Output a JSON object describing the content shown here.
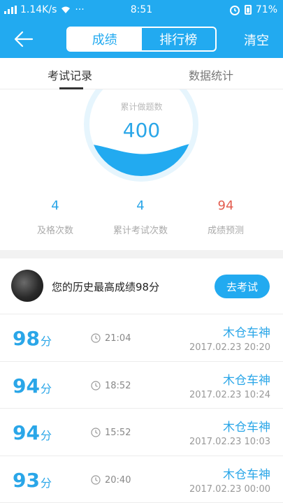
{
  "status": {
    "speed": "1.14K/s",
    "dots": "···",
    "time": "8:51",
    "battery": "71%"
  },
  "header": {
    "segments": [
      "成绩",
      "排行榜"
    ],
    "clear": "清空"
  },
  "tabs": [
    "考试记录",
    "数据统计"
  ],
  "gauge": {
    "title": "累计做题数",
    "value": "400"
  },
  "stats": [
    {
      "value": "4",
      "label": "及格次数",
      "color": "#2aa6e8"
    },
    {
      "value": "4",
      "label": "累计考试次数",
      "color": "#2aa6e8"
    },
    {
      "value": "94",
      "label": "成绩预测",
      "color": "#e35c4f"
    }
  ],
  "best": {
    "text": "您的历史最高成绩98分",
    "button": "去考试"
  },
  "records": [
    {
      "score": "98",
      "unit": "分",
      "duration": "21:04",
      "name": "木仓车神",
      "date": "2017.02.23  20:20"
    },
    {
      "score": "94",
      "unit": "分",
      "duration": "18:52",
      "name": "木仓车神",
      "date": "2017.02.23  10:24"
    },
    {
      "score": "94",
      "unit": "分",
      "duration": "15:52",
      "name": "木仓车神",
      "date": "2017.02.23  10:03"
    },
    {
      "score": "93",
      "unit": "分",
      "duration": "20:40",
      "name": "木仓车神",
      "date": "2017.02.23  00:00"
    }
  ],
  "colors": {
    "accent": "#22aaf0",
    "prediction": "#e35c4f"
  }
}
